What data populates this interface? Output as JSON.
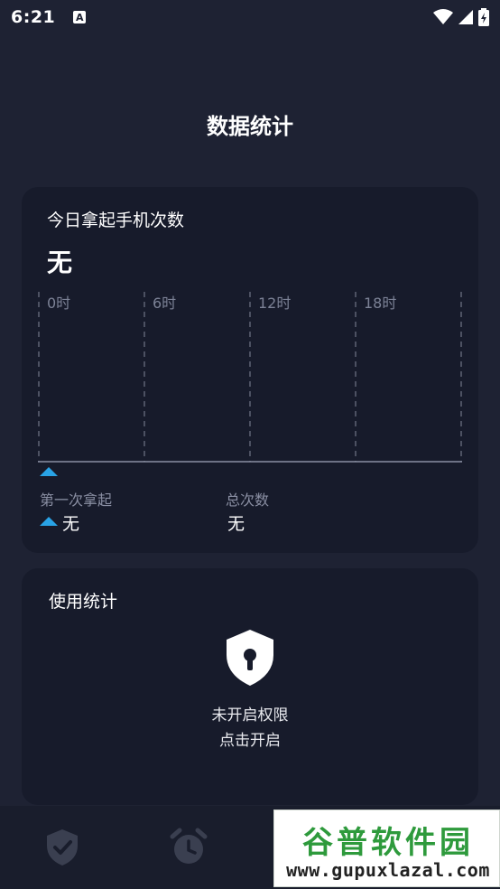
{
  "status_bar": {
    "time": "6:21",
    "indicator": "A"
  },
  "header": {
    "title": "数据统计"
  },
  "pickups_card": {
    "title": "今日拿起手机次数",
    "value": "无",
    "chart_hours": [
      "0时",
      "6时",
      "12时",
      "18时"
    ],
    "first_pickup_label": "第一次拿起",
    "first_pickup_value": "无",
    "total_label": "总次数",
    "total_value": "无"
  },
  "usage_card": {
    "title": "使用统计",
    "permission_line1": "未开启权限",
    "permission_line2": "点击开启"
  },
  "tab_bar": {
    "icons": [
      "shield-check-icon",
      "alarm-clock-icon"
    ]
  },
  "watermark": {
    "title": "谷普软件园",
    "url": "www.gupuxlazal.com"
  },
  "colors": {
    "background": "#1e2233",
    "card": "#171b2b",
    "accent": "#29a3e6",
    "muted_text": "#8a8fa3",
    "watermark_green": "#2e9a3c"
  }
}
